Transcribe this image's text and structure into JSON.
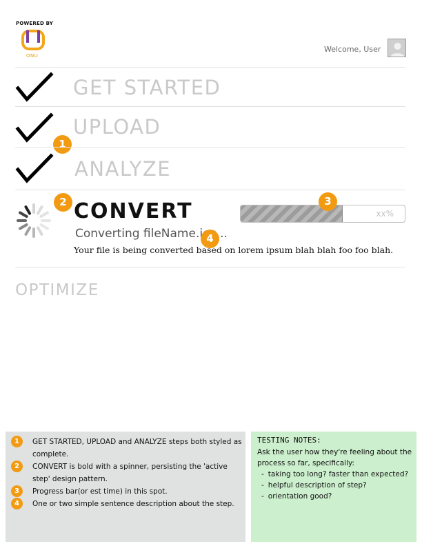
{
  "header": {
    "powered_by": "POWERED BY",
    "brand": "ONU",
    "welcome": "Welcome, User"
  },
  "steps": {
    "get_started": "GET STARTED",
    "upload": "UPLOAD",
    "analyze": "ANALYZE",
    "convert": "CONVERT",
    "optimize": "OPTIMIZE"
  },
  "convert": {
    "status": "Converting fileName.igs...",
    "description": "Your file is being converted based on lorem ipsum blah blah foo foo blah.",
    "progress_label": "xx%",
    "progress_fraction": 0.62
  },
  "callouts": [
    "1",
    "2",
    "3",
    "4"
  ],
  "notes": {
    "items": [
      {
        "num": "1",
        "text": "GET STARTED, UPLOAD and ANALYZE steps both styled as complete."
      },
      {
        "num": "2",
        "text": "CONVERT is bold with a spinner, persisting the 'active step' design pattern."
      },
      {
        "num": "3",
        "text": "Progress bar(or est time) in this spot."
      },
      {
        "num": "4",
        "text": "One or two simple sentence description about the step."
      }
    ]
  },
  "testing": {
    "title": "TESTING NOTES:",
    "intro": "Ask the user how they're feeling about the process so far, specifically:",
    "items": [
      "taking too long? faster than expected?",
      "helpful description of step?",
      "orientation good?"
    ]
  },
  "colors": {
    "accent": "#f29b12",
    "complete_text": "#c9c9c9",
    "notes_bg": "#e0e1e1",
    "testing_bg": "#ccefcd"
  },
  "icons": [
    "onu-logo-icon",
    "avatar-icon",
    "checkmark-icon",
    "spinner-icon"
  ]
}
